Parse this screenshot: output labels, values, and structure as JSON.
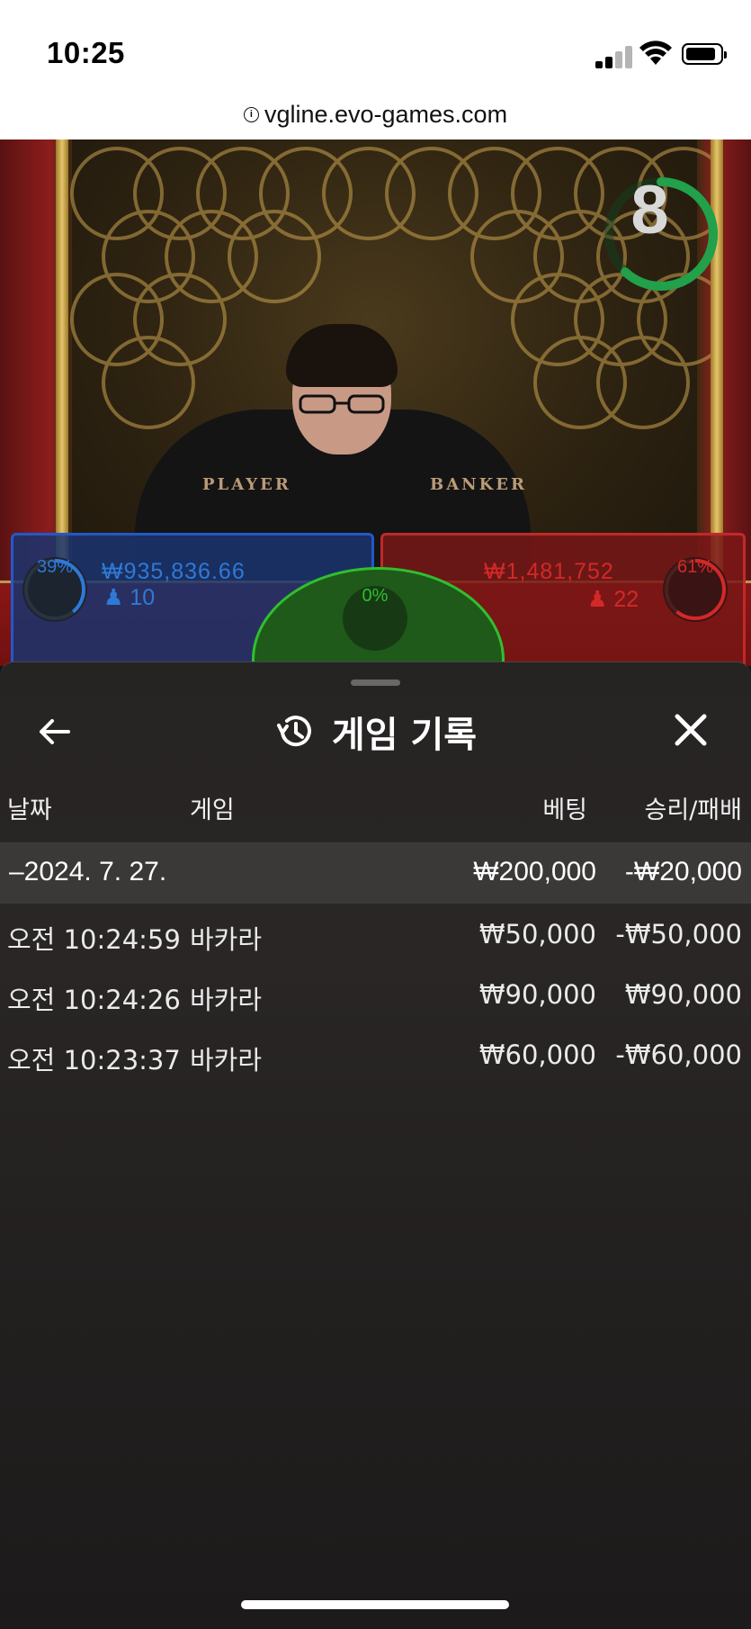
{
  "status_bar": {
    "time": "10:25"
  },
  "browser": {
    "url": "vgline.evo-games.com"
  },
  "video": {
    "timer": "8",
    "table_labels": {
      "player": "PLAYER",
      "banker": "BANKER"
    },
    "player": {
      "percent": "39%",
      "amount": "₩935,836.66",
      "count": "10"
    },
    "banker": {
      "percent": "61%",
      "amount": "₩1,481,752",
      "count": "22"
    },
    "tie": {
      "percent": "0%"
    }
  },
  "sheet": {
    "title": "게임 기록",
    "columns": {
      "date": "날짜",
      "game": "게임",
      "bet": "베팅",
      "win_loss": "승리/패배"
    },
    "summary": {
      "date": "–2024. 7. 27.",
      "bet": "₩200,000",
      "win_loss": "-₩20,000"
    },
    "rows": [
      {
        "time": "오전 10:24:59",
        "game": "바카라",
        "bet": "₩50,000",
        "win_loss": "-₩50,000"
      },
      {
        "time": "오전 10:24:26",
        "game": "바카라",
        "bet": "₩90,000",
        "win_loss": "₩90,000"
      },
      {
        "time": "오전 10:23:37",
        "game": "바카라",
        "bet": "₩60,000",
        "win_loss": "-₩60,000"
      }
    ]
  },
  "colors": {
    "player": "#2f79d6",
    "banker": "#d42828",
    "tie": "#2fbf2f",
    "timer": "#22a04a"
  },
  "icons": {
    "back": "back-arrow-icon",
    "history": "history-icon",
    "close": "close-icon",
    "person": "person-icon"
  }
}
